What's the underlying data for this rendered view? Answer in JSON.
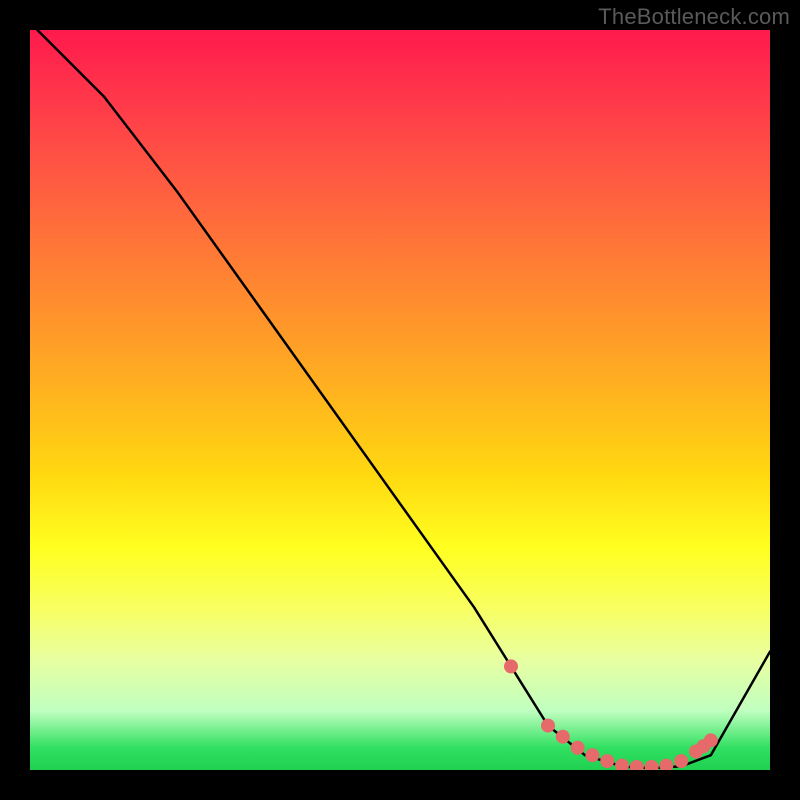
{
  "watermark": "TheBottleneck.com",
  "chart_data": {
    "type": "line",
    "title": "",
    "xlabel": "",
    "ylabel": "",
    "xlim": [
      0,
      100
    ],
    "ylim": [
      0,
      100
    ],
    "series": [
      {
        "name": "curve",
        "x": [
          1,
          10,
          20,
          30,
          40,
          50,
          60,
          65,
          70,
          75,
          80,
          82,
          85,
          88,
          92,
          100
        ],
        "values": [
          100,
          91,
          78,
          64,
          50,
          36,
          22,
          14,
          6,
          2,
          0.5,
          0.3,
          0.3,
          0.5,
          2,
          16
        ]
      }
    ],
    "markers": {
      "name": "dots",
      "color": "#e76a6a",
      "x": [
        65,
        70,
        72,
        74,
        76,
        78,
        80,
        82,
        84,
        86,
        88,
        90,
        91,
        92
      ],
      "values": [
        14,
        6,
        4.5,
        3,
        2,
        1.2,
        0.6,
        0.4,
        0.4,
        0.6,
        1.2,
        2.5,
        3.2,
        4
      ]
    }
  }
}
